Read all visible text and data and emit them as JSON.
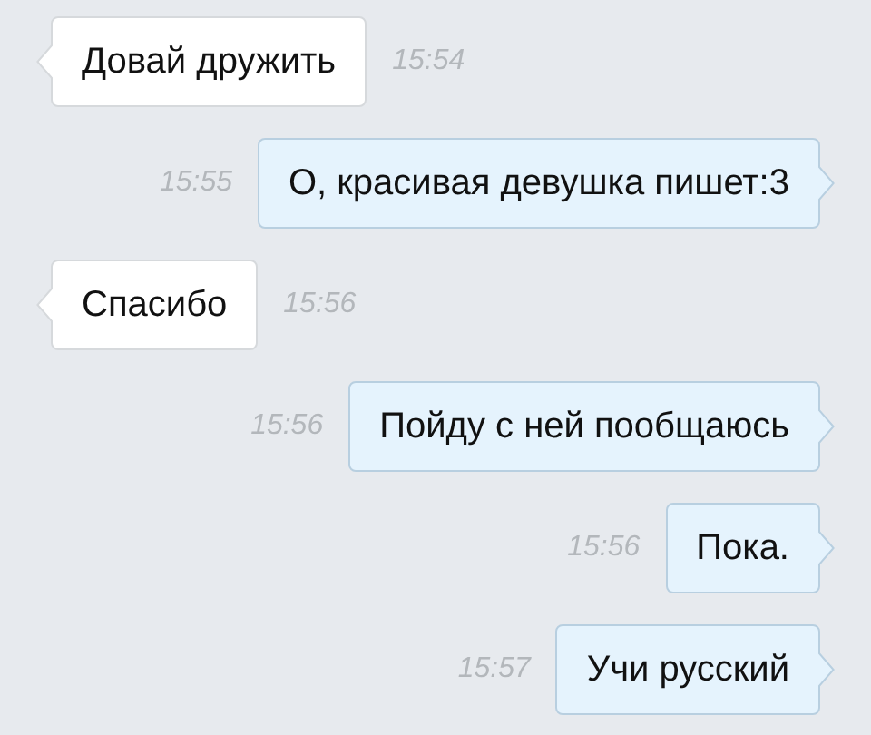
{
  "messages": [
    {
      "kind": "incoming",
      "text": "Довай дружить",
      "time": "15:54"
    },
    {
      "kind": "outgoing",
      "text": "О, красивая девушка пишет:3",
      "time": "15:55"
    },
    {
      "kind": "incoming",
      "text": "Спасибо",
      "time": "15:56"
    },
    {
      "kind": "outgoing",
      "text": "Пойду с ней пообщаюсь",
      "time": "15:56"
    },
    {
      "kind": "outgoing",
      "text": "Пока.",
      "time": "15:56"
    },
    {
      "kind": "outgoing",
      "text": "Учи русский",
      "time": "15:57"
    }
  ]
}
